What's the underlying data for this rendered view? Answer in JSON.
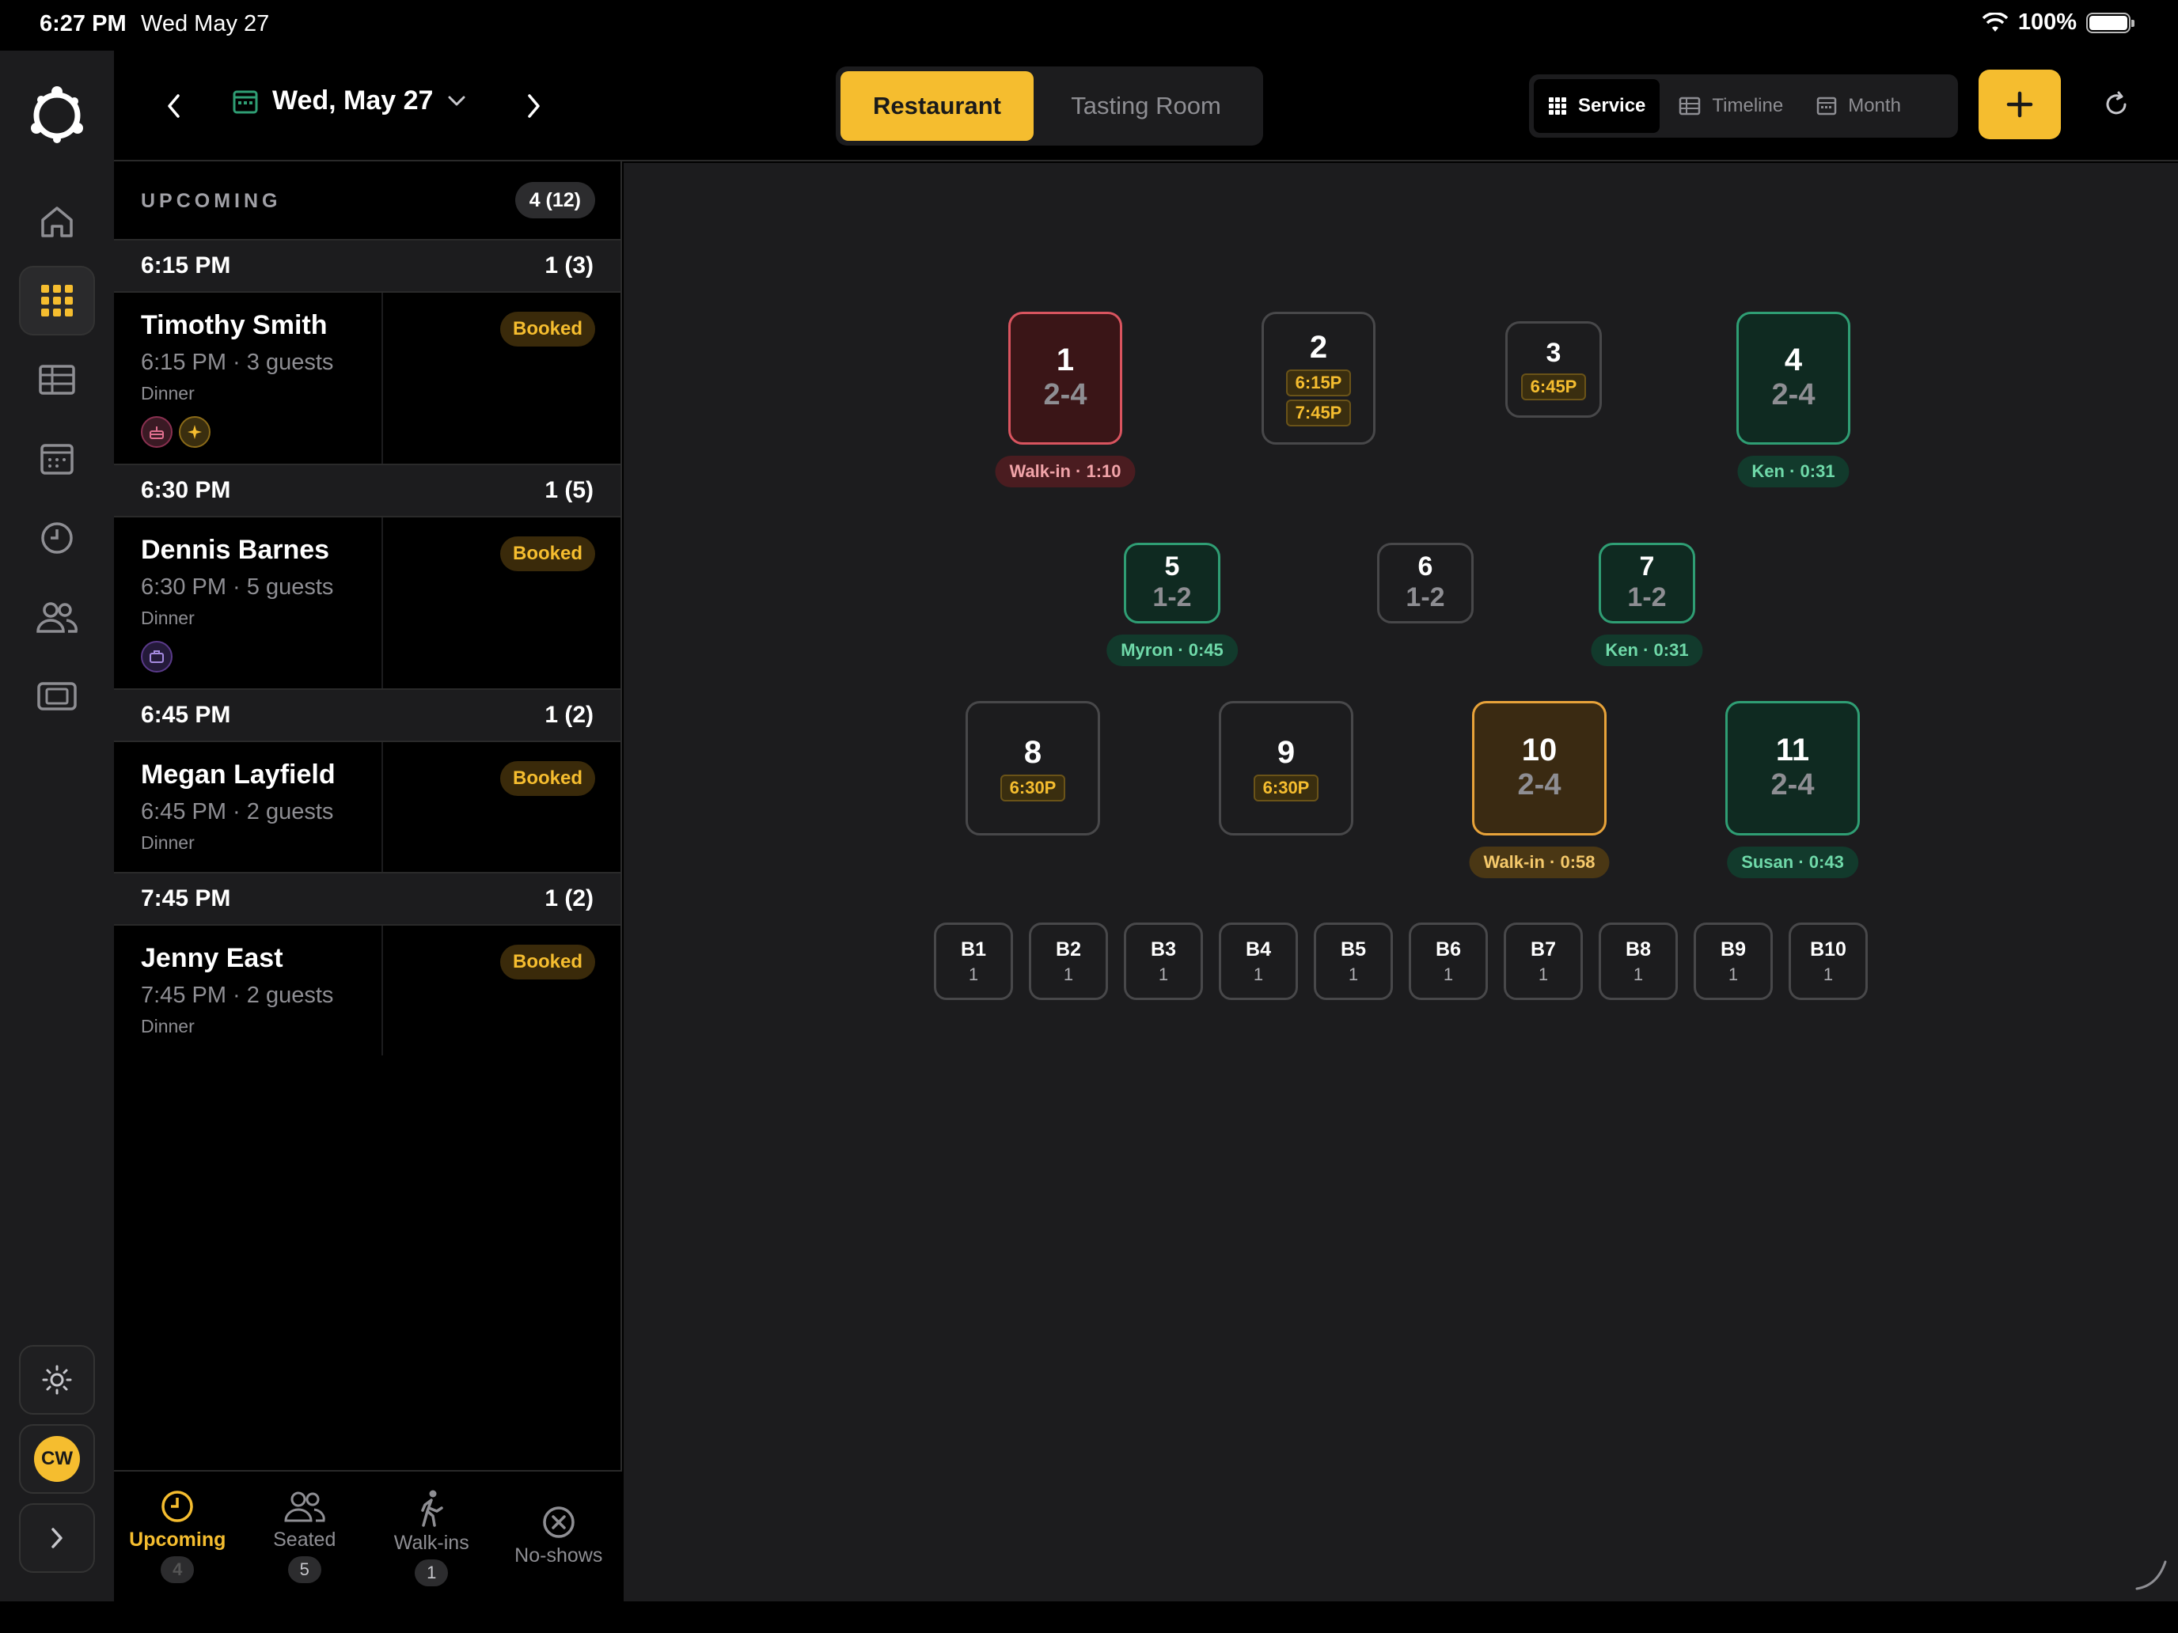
{
  "status_bar": {
    "time": "6:27 PM",
    "date": "Wed May 27",
    "battery": "100%"
  },
  "topbar": {
    "date": "Wed, May 27",
    "rooms": [
      "Restaurant",
      "Tasting Room"
    ],
    "views": [
      "Service",
      "Timeline",
      "Month"
    ]
  },
  "panel": {
    "title": "UPCOMING",
    "count": "4 (12)",
    "groups": [
      {
        "time": "6:15 PM",
        "count": "1 (3)",
        "res": {
          "name": "Timothy Smith",
          "meta": "6:15 PM · 3 guests",
          "type": "Dinner",
          "status": "Booked"
        }
      },
      {
        "time": "6:30 PM",
        "count": "1 (5)",
        "res": {
          "name": "Dennis Barnes",
          "meta": "6:30 PM · 5 guests",
          "type": "Dinner",
          "status": "Booked"
        }
      },
      {
        "time": "6:45 PM",
        "count": "1 (2)",
        "res": {
          "name": "Megan Layfield",
          "meta": "6:45 PM · 2 guests",
          "type": "Dinner",
          "status": "Booked"
        }
      },
      {
        "time": "7:45 PM",
        "count": "1 (2)",
        "res": {
          "name": "Jenny East",
          "meta": "7:45 PM · 2 guests",
          "type": "Dinner",
          "status": "Booked"
        }
      }
    ]
  },
  "bottom_tabs": [
    {
      "label": "Upcoming",
      "count": "4"
    },
    {
      "label": "Seated",
      "count": "5"
    },
    {
      "label": "Walk-ins",
      "count": "1"
    },
    {
      "label": "No-shows",
      "count": ""
    }
  ],
  "user": {
    "initials": "CW"
  },
  "tables": [
    {
      "num": "1",
      "cap": "2-4",
      "status_text": "Walk-in · 1:10"
    },
    {
      "num": "2",
      "times": [
        "6:15P",
        "7:45P"
      ]
    },
    {
      "num": "3",
      "times": [
        "6:45P"
      ]
    },
    {
      "num": "4",
      "cap": "2-4",
      "status_text": "Ken · 0:31"
    },
    {
      "num": "5",
      "cap": "1-2",
      "status_text": "Myron · 0:45"
    },
    {
      "num": "6",
      "cap": "1-2"
    },
    {
      "num": "7",
      "cap": "1-2",
      "status_text": "Ken · 0:31"
    },
    {
      "num": "8",
      "times": [
        "6:30P"
      ]
    },
    {
      "num": "9",
      "times": [
        "6:30P"
      ]
    },
    {
      "num": "10",
      "cap": "2-4",
      "status_text": "Walk-in · 0:58"
    },
    {
      "num": "11",
      "cap": "2-4",
      "status_text": "Susan · 0:43"
    }
  ],
  "bar_seats": [
    {
      "name": "B1",
      "cap": "1"
    },
    {
      "name": "B2",
      "cap": "1"
    },
    {
      "name": "B3",
      "cap": "1"
    },
    {
      "name": "B4",
      "cap": "1"
    },
    {
      "name": "B5",
      "cap": "1"
    },
    {
      "name": "B6",
      "cap": "1"
    },
    {
      "name": "B7",
      "cap": "1"
    },
    {
      "name": "B8",
      "cap": "1"
    },
    {
      "name": "B9",
      "cap": "1"
    },
    {
      "name": "B10",
      "cap": "1"
    }
  ],
  "colors": {
    "accent": "#f5bd2f",
    "seated": "#2f9e74",
    "walkin_red": "#d9545f",
    "walkin_amber": "#e8a33a"
  }
}
